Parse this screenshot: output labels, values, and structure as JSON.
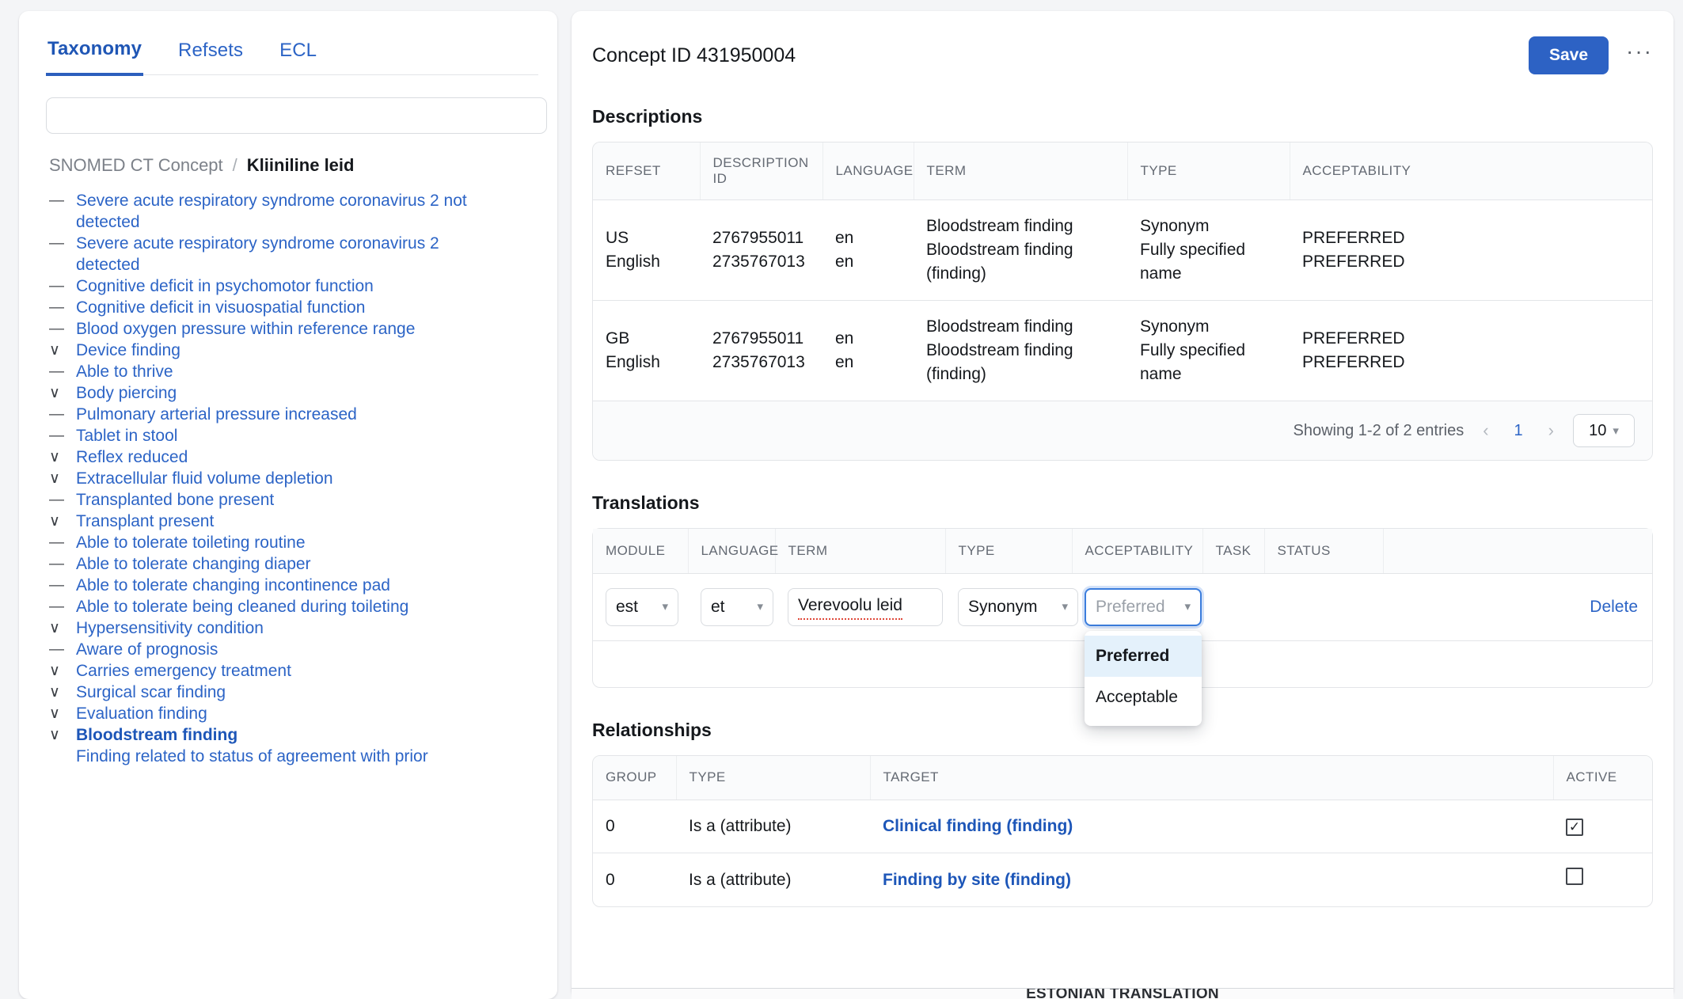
{
  "left": {
    "tabs": [
      {
        "label": "Taxonomy",
        "active": true
      },
      {
        "label": "Refsets",
        "active": false
      },
      {
        "label": "ECL",
        "active": false
      }
    ],
    "search": {
      "value": "",
      "placeholder": ""
    },
    "breadcrumb": {
      "root": "SNOMED CT Concept",
      "separator": "/",
      "leaf": "Kliiniline leid"
    },
    "tree": [
      {
        "icon": "dash",
        "label": "Severe acute respiratory syndrome coronavirus 2 not detected",
        "selected": false
      },
      {
        "icon": "dash",
        "label": "Severe acute respiratory syndrome coronavirus 2 detected",
        "selected": false
      },
      {
        "icon": "dash",
        "label": "Cognitive deficit in psychomotor function",
        "selected": false
      },
      {
        "icon": "dash",
        "label": "Cognitive deficit in visuospatial function",
        "selected": false
      },
      {
        "icon": "dash",
        "label": "Blood oxygen pressure within reference range",
        "selected": false
      },
      {
        "icon": "chevron",
        "label": "Device finding",
        "selected": false
      },
      {
        "icon": "dash",
        "label": "Able to thrive",
        "selected": false
      },
      {
        "icon": "chevron",
        "label": "Body piercing",
        "selected": false
      },
      {
        "icon": "dash",
        "label": "Pulmonary arterial pressure increased",
        "selected": false
      },
      {
        "icon": "dash",
        "label": "Tablet in stool",
        "selected": false
      },
      {
        "icon": "chevron",
        "label": "Reflex reduced",
        "selected": false
      },
      {
        "icon": "chevron",
        "label": "Extracellular fluid volume depletion",
        "selected": false
      },
      {
        "icon": "dash",
        "label": "Transplanted bone present",
        "selected": false
      },
      {
        "icon": "chevron",
        "label": "Transplant present",
        "selected": false
      },
      {
        "icon": "dash",
        "label": "Able to tolerate toileting routine",
        "selected": false
      },
      {
        "icon": "dash",
        "label": "Able to tolerate changing diaper",
        "selected": false
      },
      {
        "icon": "dash",
        "label": "Able to tolerate changing incontinence pad",
        "selected": false
      },
      {
        "icon": "dash",
        "label": "Able to tolerate being cleaned during toileting",
        "selected": false
      },
      {
        "icon": "chevron",
        "label": "Hypersensitivity condition",
        "selected": false
      },
      {
        "icon": "dash",
        "label": "Aware of prognosis",
        "selected": false
      },
      {
        "icon": "chevron",
        "label": "Carries emergency treatment",
        "selected": false
      },
      {
        "icon": "chevron",
        "label": "Surgical scar finding",
        "selected": false
      },
      {
        "icon": "chevron",
        "label": "Evaluation finding",
        "selected": false
      },
      {
        "icon": "chevron",
        "label": "Bloodstream finding",
        "selected": true
      },
      {
        "icon": "blank",
        "label": "Finding related to status of agreement with prior",
        "selected": false
      }
    ]
  },
  "right": {
    "header": {
      "title": "Concept ID 431950004",
      "save_label": "Save",
      "menu_label": "···"
    },
    "descriptions": {
      "title": "Descriptions",
      "columns": [
        "REFSET",
        "DESCRIPTION ID",
        "LANGUAGE",
        "TERM",
        "TYPE",
        "ACCEPTABILITY"
      ],
      "rows": [
        {
          "refset": [
            "US",
            "English"
          ],
          "description_id": [
            "2767955011",
            "2735767013"
          ],
          "language": [
            "en",
            "en"
          ],
          "term": [
            "Bloodstream finding",
            "Bloodstream finding",
            "(finding)"
          ],
          "type": [
            "Synonym",
            "Fully specified",
            "name"
          ],
          "acceptability": [
            "PREFERRED",
            "PREFERRED"
          ]
        },
        {
          "refset": [
            "GB",
            "English"
          ],
          "description_id": [
            "2767955011",
            "2735767013"
          ],
          "language": [
            "en",
            "en"
          ],
          "term": [
            "Bloodstream finding",
            "Bloodstream finding",
            "(finding)"
          ],
          "type": [
            "Synonym",
            "Fully specified",
            "name"
          ],
          "acceptability": [
            "PREFERRED",
            "PREFERRED"
          ]
        }
      ],
      "pager": {
        "showing": "Showing 1-2 of 2 entries",
        "prev_icon": "‹",
        "page": "1",
        "next_icon": "›",
        "page_size": "10"
      }
    },
    "translations": {
      "title": "Translations",
      "columns": [
        "MODULE",
        "LANGUAGE",
        "TERM",
        "TYPE",
        "ACCEPTABILITY",
        "TASK",
        "STATUS",
        ""
      ],
      "row": {
        "module": "est",
        "language": "et",
        "term": "Verevoolu leid",
        "type": "Synonym",
        "acceptability_placeholder": "Preferred",
        "task": "",
        "status": "",
        "delete_label": "Delete"
      },
      "dropdown": {
        "open": true,
        "options": [
          {
            "label": "Preferred",
            "active": true
          },
          {
            "label": "Acceptable",
            "active": false
          }
        ]
      },
      "add_row_icon": "+"
    },
    "relationships": {
      "title": "Relationships",
      "columns": [
        "GROUP",
        "TYPE",
        "TARGET",
        "ACTIVE"
      ],
      "rows": [
        {
          "group": "0",
          "type": "Is a (attribute)",
          "target": "Clinical finding (finding)",
          "active": true
        },
        {
          "group": "0",
          "type": "Is a (attribute)",
          "target": "Finding by site (finding)",
          "active": false
        }
      ],
      "checked_glyph": "✓",
      "unchecked_glyph": ""
    }
  },
  "footer_peek": {
    "text": "ESTONIAN TRANSLATION"
  },
  "colors": {
    "accent": "#2d62c4",
    "link": "#2c64c6",
    "border": "#e3e5e8",
    "header_bg": "#fafbfc",
    "page_bg": "#f4f5f7",
    "focus_ring": "#3b7ddd",
    "dropdown_active_bg": "#e4f1fb",
    "spellcheck": "#e0483a"
  }
}
